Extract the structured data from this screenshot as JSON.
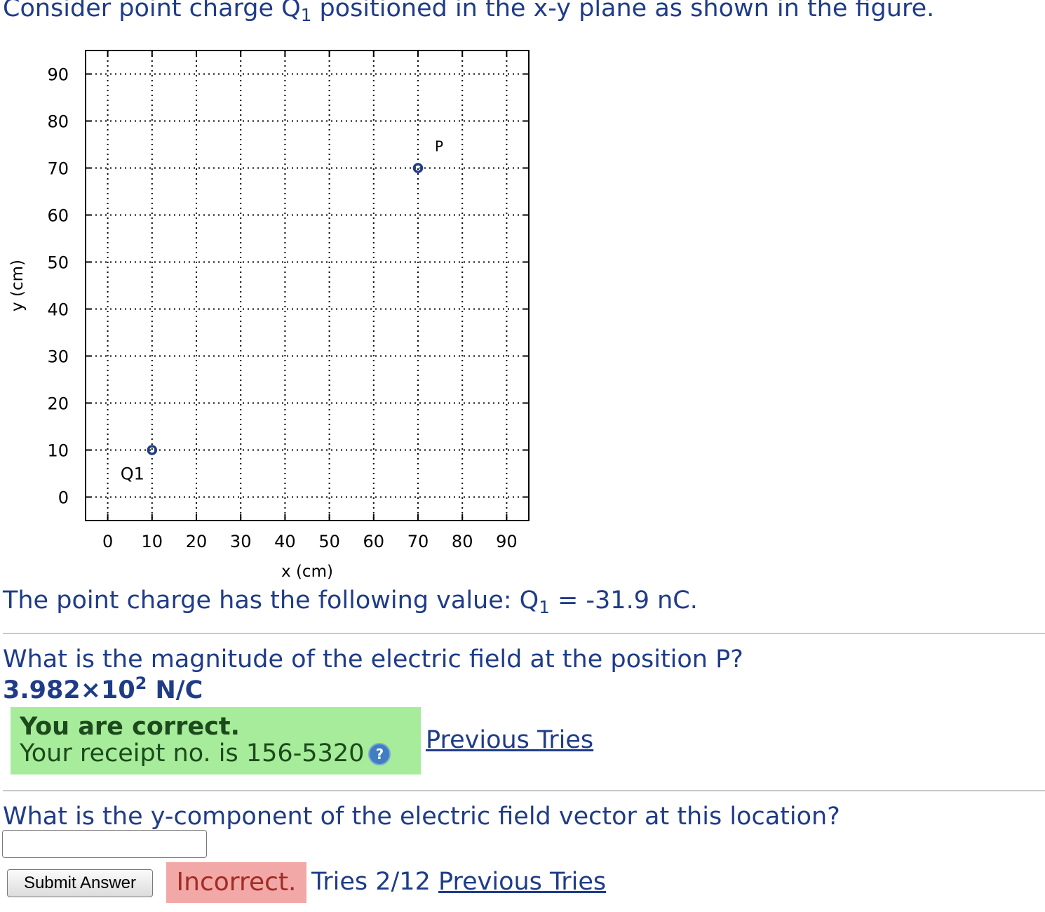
{
  "intro": {
    "before": "Consider point charge Q",
    "sub": "1",
    "after": " positioned in the x-y plane as shown in the figure."
  },
  "chart_data": {
    "type": "scatter",
    "xlabel": "x (cm)",
    "ylabel": "y (cm)",
    "xlim": [
      -5,
      95
    ],
    "ylim": [
      -5,
      95
    ],
    "x_ticks": [
      0,
      10,
      20,
      30,
      40,
      50,
      60,
      70,
      80,
      90
    ],
    "y_ticks": [
      0,
      10,
      20,
      30,
      40,
      50,
      60,
      70,
      80,
      90
    ],
    "grid": true,
    "points": [
      {
        "label": "Q1",
        "x": 10,
        "y": 10,
        "label_position": "below-left"
      },
      {
        "label": "P",
        "x": 70,
        "y": 70,
        "label_position": "above-right"
      }
    ],
    "marker_color": "#1f3c88"
  },
  "charge_value": {
    "before": "The point charge has the following value: Q",
    "sub": "1",
    "after": " = -31.9 nC."
  },
  "question1": {
    "prompt": "What is the magnitude of the electric field at the position P?",
    "answer_base": "3.982×10",
    "answer_exp": "2",
    "answer_unit": " N/C",
    "feedback_title": "You are correct.",
    "receipt": "Your receipt no. is 156-5320",
    "help_icon": "question-mark-icon",
    "previous_tries": "Previous Tries"
  },
  "question2": {
    "prompt": "What is the y-component of the electric field vector at this location?",
    "input_value": "",
    "submit_label": "Submit Answer",
    "feedback": "Incorrect.",
    "tries": "Tries 2/12",
    "previous_tries": "Previous Tries"
  },
  "colors": {
    "text": "#1f3c88",
    "correct_bg": "#a6ec9a",
    "incorrect_bg": "#f1a8a6",
    "incorrect_text": "#a12c26"
  }
}
